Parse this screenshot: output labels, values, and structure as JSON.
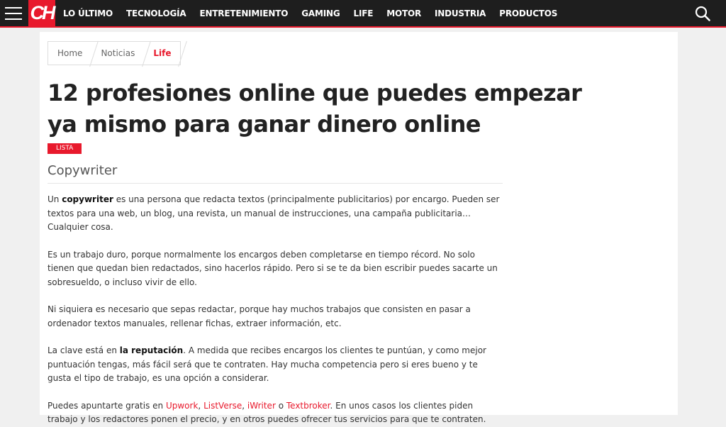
{
  "header": {
    "logo_text": "CH",
    "nav": [
      "LO ÚLTIMO",
      "TECNOLOGÍA",
      "ENTRETENIMIENTO",
      "GAMING",
      "LIFE",
      "MOTOR",
      "INDUSTRIA",
      "PRODUCTOS"
    ],
    "icons": {
      "menu": "hamburger-menu-icon",
      "search": "search-icon"
    },
    "accent": "#e8192c"
  },
  "breadcrumb": [
    "Home",
    "Noticias",
    "Life"
  ],
  "article": {
    "title": "12 profesiones online que puedes empezar ya mismo para ganar dinero online",
    "tag": "LISTA",
    "section_title": "Copywriter",
    "p1": {
      "a": "Un ",
      "b": "copywriter",
      "c": " es una persona que redacta textos (principalmente publicitarios) por encargo. Pueden ser textos para una web, un blog, una revista, un manual de instrucciones, una campaña publicitaria… Cualquier cosa."
    },
    "p2": "Es un trabajo duro, porque normalmente los encargos deben completarse en tiempo récord. No solo tienen que quedan bien redactados, sino hacerlos rápido. Pero si se te da bien escribir puedes sacarte un sobresueldo, o incluso vivir de ello.",
    "p3": "Ni siquiera es necesario que sepas redactar, porque hay muchos trabajos que consisten en pasar a ordenador textos manuales, rellenar fichas, extraer información, etc.",
    "p4": {
      "a": "La clave está en ",
      "b": "la reputación",
      "c": ". A medida que recibes encargos los clientes te puntúan, y como mejor puntuación tengas, más fácil será que te contraten. Hay mucha competencia pero si eres bueno y te gusta el tipo de trabajo, es una opción a considerar."
    },
    "p5": {
      "a": "Puedes apuntarte gratis en ",
      "link1": "Upwork",
      "sep1": ", ",
      "link2": "ListVerse",
      "sep2": ", ",
      "link3": "iWriter",
      "sep3": " o ",
      "link4": "Textbroker",
      "c": ". En unos casos los clientes piden trabajo y los redactores ponen el precio, y en otros puedes ofrecer tus servicios para que te contraten."
    }
  }
}
